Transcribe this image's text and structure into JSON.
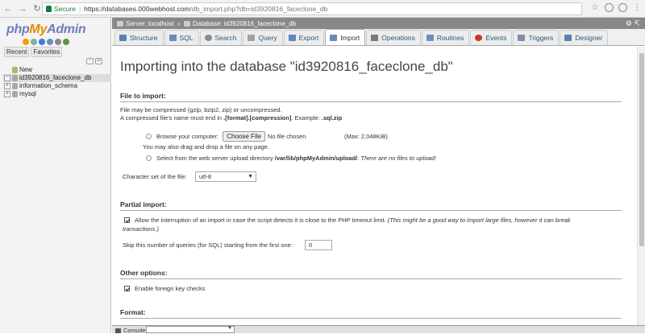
{
  "browser": {
    "secure_label": "Secure",
    "url_domain": "https://databases.000webhost.com",
    "url_path": "/db_import.php?db=id3920816_faceclone_db"
  },
  "sidebar": {
    "logo_php": "php",
    "logo_my": "My",
    "logo_admin": "Admin",
    "tabs": [
      "Recent",
      "Favorites"
    ],
    "tree": [
      {
        "label": "New"
      },
      {
        "label": "id3920816_faceclone_db"
      },
      {
        "label": "information_schema"
      },
      {
        "label": "mysql"
      }
    ]
  },
  "breadcrumb": {
    "server": "Server: localhost",
    "database": "Database: id3920816_faceclone_db"
  },
  "tabs": [
    {
      "label": "Structure",
      "color": "#5a7fb0"
    },
    {
      "label": "SQL",
      "color": "#6b8bb8"
    },
    {
      "label": "Search",
      "color": "#8a8a8a"
    },
    {
      "label": "Query",
      "color": "#a0a0a0"
    },
    {
      "label": "Export",
      "color": "#5f87c0"
    },
    {
      "label": "Import",
      "color": "#6b8bb8"
    },
    {
      "label": "Operations",
      "color": "#7a7a7a"
    },
    {
      "label": "Routines",
      "color": "#6d8fb8"
    },
    {
      "label": "Events",
      "color": "#c0392b"
    },
    {
      "label": "Triggers",
      "color": "#7f8fa6"
    },
    {
      "label": "Designer",
      "color": "#5a7fb0"
    }
  ],
  "main": {
    "title": "Importing into the database \"id3920816_faceclone_db\"",
    "file_section": {
      "heading": "File to import:",
      "compress_note": "File may be compressed (gzip, bzip2, zip) or uncompressed.",
      "name_note_prefix": "A compressed file's name must end in ",
      "name_note_format": ".[format].[compression]",
      "name_note_example_prefix": ". Example: ",
      "name_note_example": ".sql.zip",
      "browse_label": "Browse your computer:",
      "choose_file_btn": "Choose File",
      "no_file": "No file chosen",
      "max_size": "(Max: 2,048KiB)",
      "drag_note": "You may also drag and drop a file on any page.",
      "server_dir_prefix": "Select from the web server upload directory ",
      "server_dir_path": "/var/lib/phpMyAdmin/upload/",
      "server_dir_note": "There are no files to upload!",
      "charset_label": "Character set of the file:",
      "charset_value": "utf-8"
    },
    "partial_section": {
      "heading": "Partial import:",
      "allow_interrupt": "Allow the interruption of an import in case the script detects it is close to the PHP timeout limit.",
      "allow_interrupt_note_1": "(This might be a good way to import large files, however it can break",
      "allow_interrupt_note_2": "transactions.)",
      "skip_label": "Skip this number of queries (for SQL) starting from the first one:",
      "skip_value": "0"
    },
    "other_section": {
      "heading": "Other options:",
      "foreign_keys": "Enable foreign key checks"
    },
    "format_section": {
      "heading": "Format:"
    }
  },
  "console": {
    "label": "Console"
  }
}
